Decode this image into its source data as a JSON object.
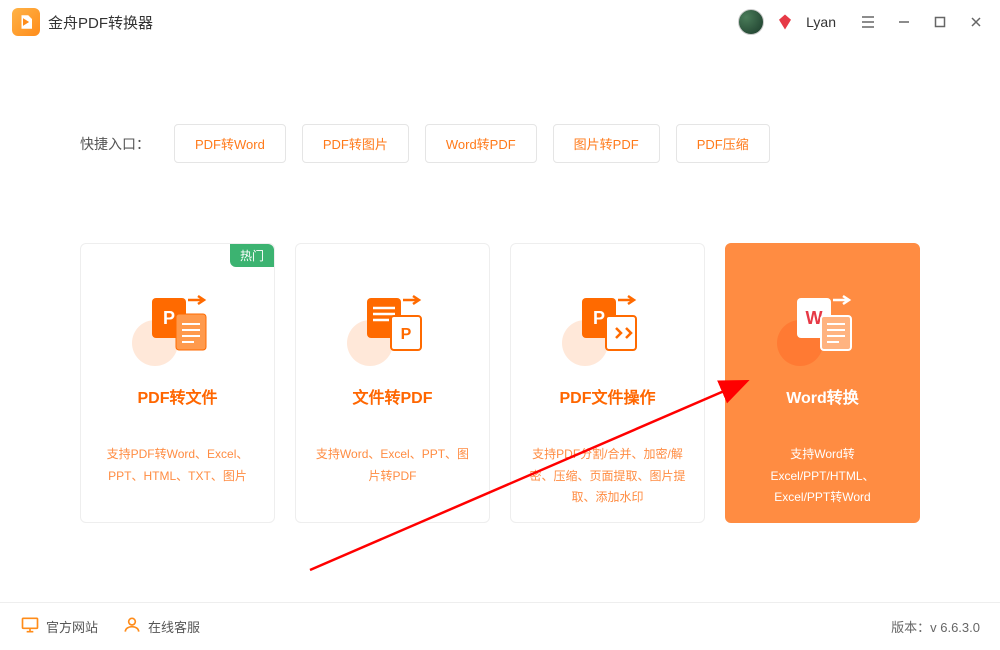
{
  "app": {
    "title": "金舟PDF转换器"
  },
  "user": {
    "name": "Lyan"
  },
  "quickEntry": {
    "label": "快捷入口：",
    "buttons": [
      "PDF转Word",
      "PDF转图片",
      "Word转PDF",
      "图片转PDF",
      "PDF压缩"
    ]
  },
  "cards": [
    {
      "title": "PDF转文件",
      "desc": "支持PDF转Word、Excel、PPT、HTML、TXT、图片",
      "badge": "热门"
    },
    {
      "title": "文件转PDF",
      "desc": "支持Word、Excel、PPT、图片转PDF"
    },
    {
      "title": "PDF文件操作",
      "desc": "支持PDF分割/合并、加密/解密、压缩、页面提取、图片提取、添加水印"
    },
    {
      "title": "Word转换",
      "desc": "支持Word转Excel/PPT/HTML、Excel/PPT转Word"
    }
  ],
  "footer": {
    "website": "官方网站",
    "support": "在线客服",
    "versionLabel": "版本：",
    "version": "v 6.6.3.0"
  }
}
